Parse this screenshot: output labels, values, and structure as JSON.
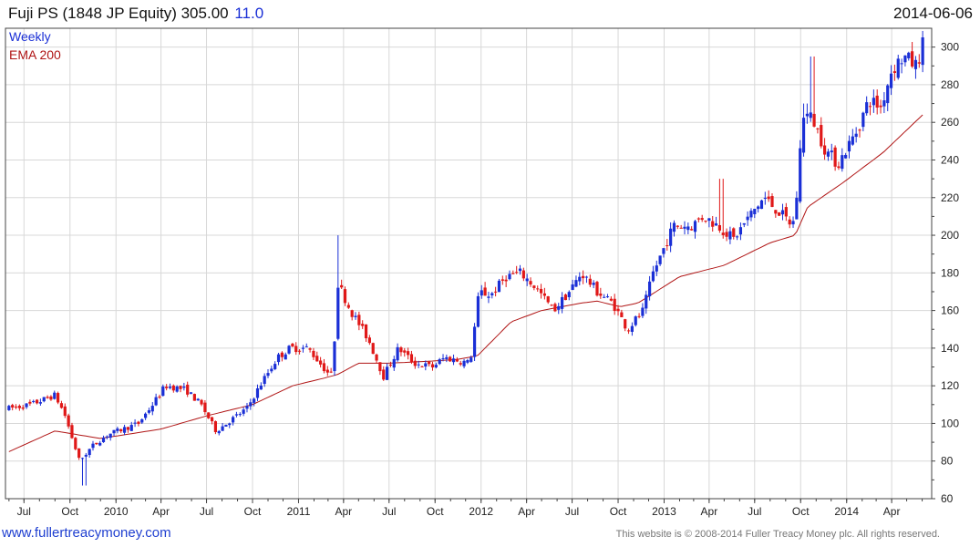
{
  "header": {
    "title": "Fuji PS (1848 JP Equity) 305.00",
    "change": "11.0",
    "date": "2014-06-06"
  },
  "footer": {
    "website": "www.fullertreacymoney.com",
    "copyright": "This website is © 2008-2014 Fuller Treacy Money plc. All rights reserved."
  },
  "colors": {
    "up": "#1a2fd6",
    "down": "#e01818",
    "ema": "#b01515",
    "grid": "#d8d8d8",
    "legend_weekly": "#1a2fd6",
    "legend_ema": "#b01515"
  },
  "chart_data": {
    "type": "candlestick",
    "frequency": "weekly",
    "legend": [
      "Weekly",
      "EMA 200"
    ],
    "ylim": [
      60,
      310
    ],
    "y_ticks": [
      60,
      80,
      100,
      120,
      140,
      160,
      180,
      200,
      220,
      240,
      260,
      280,
      300
    ],
    "x_tick_labels": [
      "Jul",
      "Oct",
      "2010",
      "Apr",
      "Jul",
      "Oct",
      "2011",
      "Apr",
      "Jul",
      "Oct",
      "2012",
      "Apr",
      "Jul",
      "Oct",
      "2013",
      "Apr",
      "Jul",
      "Oct",
      "2014",
      "Apr"
    ],
    "grid": true,
    "legend_position": "top-left",
    "price_keypoints": [
      [
        "2009-06-01",
        108
      ],
      [
        "2009-07-15",
        110
      ],
      [
        "2009-09-01",
        115
      ],
      [
        "2009-09-20",
        105
      ],
      [
        "2009-10-20",
        80
      ],
      [
        "2009-11-15",
        88
      ],
      [
        "2009-12-15",
        94
      ],
      [
        "2010-02-15",
        100
      ],
      [
        "2010-03-15",
        110
      ],
      [
        "2010-04-10",
        120
      ],
      [
        "2010-05-20",
        118
      ],
      [
        "2010-06-20",
        110
      ],
      [
        "2010-07-20",
        96
      ],
      [
        "2010-08-20",
        102
      ],
      [
        "2010-09-20",
        108
      ],
      [
        "2010-10-20",
        122
      ],
      [
        "2010-11-20",
        135
      ],
      [
        "2010-12-15",
        140
      ],
      [
        "2011-01-20",
        140
      ],
      [
        "2011-02-25",
        128
      ],
      [
        "2011-03-10",
        125
      ],
      [
        "2011-03-20",
        175
      ],
      [
        "2011-04-15",
        160
      ],
      [
        "2011-05-20",
        145
      ],
      [
        "2011-06-20",
        125
      ],
      [
        "2011-07-20",
        140
      ],
      [
        "2011-08-20",
        132
      ],
      [
        "2011-09-25",
        130
      ],
      [
        "2011-10-20",
        135
      ],
      [
        "2011-12-10",
        132
      ],
      [
        "2011-12-28",
        170
      ],
      [
        "2012-01-20",
        168
      ],
      [
        "2012-02-20",
        178
      ],
      [
        "2012-03-20",
        180
      ],
      [
        "2012-04-20",
        172
      ],
      [
        "2012-05-25",
        160
      ],
      [
        "2012-06-25",
        170
      ],
      [
        "2012-07-20",
        180
      ],
      [
        "2012-08-20",
        170
      ],
      [
        "2012-09-20",
        164
      ],
      [
        "2012-10-20",
        150
      ],
      [
        "2012-11-20",
        160
      ],
      [
        "2012-12-10",
        180
      ],
      [
        "2013-01-20",
        205
      ],
      [
        "2013-02-25",
        205
      ],
      [
        "2013-03-20",
        210
      ],
      [
        "2013-04-20",
        205
      ],
      [
        "2013-05-20",
        198
      ],
      [
        "2013-06-20",
        210
      ],
      [
        "2013-07-20",
        220
      ],
      [
        "2013-08-20",
        212
      ],
      [
        "2013-09-15",
        205
      ],
      [
        "2013-09-25",
        225
      ],
      [
        "2013-10-05",
        265
      ],
      [
        "2013-10-25",
        262
      ],
      [
        "2013-11-20",
        245
      ],
      [
        "2013-12-15",
        238
      ],
      [
        "2014-01-20",
        255
      ],
      [
        "2014-02-15",
        272
      ],
      [
        "2014-03-10",
        268
      ],
      [
        "2014-04-01",
        288
      ],
      [
        "2014-04-25",
        295
      ],
      [
        "2014-05-20",
        290
      ],
      [
        "2014-06-06",
        305
      ]
    ],
    "ema_keypoints": [
      [
        "2009-06-01",
        85
      ],
      [
        "2009-09-01",
        96
      ],
      [
        "2009-12-01",
        92
      ],
      [
        "2010-04-01",
        97
      ],
      [
        "2010-07-01",
        104
      ],
      [
        "2010-10-01",
        110
      ],
      [
        "2010-12-20",
        120
      ],
      [
        "2011-02-20",
        124
      ],
      [
        "2011-03-20",
        126
      ],
      [
        "2011-05-01",
        132
      ],
      [
        "2011-07-01",
        132
      ],
      [
        "2011-09-15",
        133
      ],
      [
        "2011-11-15",
        134
      ],
      [
        "2011-12-25",
        136
      ],
      [
        "2012-03-01",
        154
      ],
      [
        "2012-05-01",
        160
      ],
      [
        "2012-07-20",
        164
      ],
      [
        "2012-08-20",
        165
      ],
      [
        "2012-10-05",
        162
      ],
      [
        "2012-11-10",
        164
      ],
      [
        "2013-02-01",
        178
      ],
      [
        "2013-05-01",
        184
      ],
      [
        "2013-08-01",
        196
      ],
      [
        "2013-09-20",
        200
      ],
      [
        "2013-10-15",
        215
      ],
      [
        "2013-12-25",
        228
      ],
      [
        "2014-03-15",
        244
      ],
      [
        "2014-06-06",
        265
      ]
    ],
    "spike_highs": [
      [
        "2011-03-20",
        200
      ],
      [
        "2013-04-25",
        230
      ],
      [
        "2013-10-25",
        295
      ],
      [
        "2013-10-10",
        270
      ],
      [
        "2009-10-30",
        67
      ],
      [
        "2014-06-06",
        308
      ]
    ]
  }
}
